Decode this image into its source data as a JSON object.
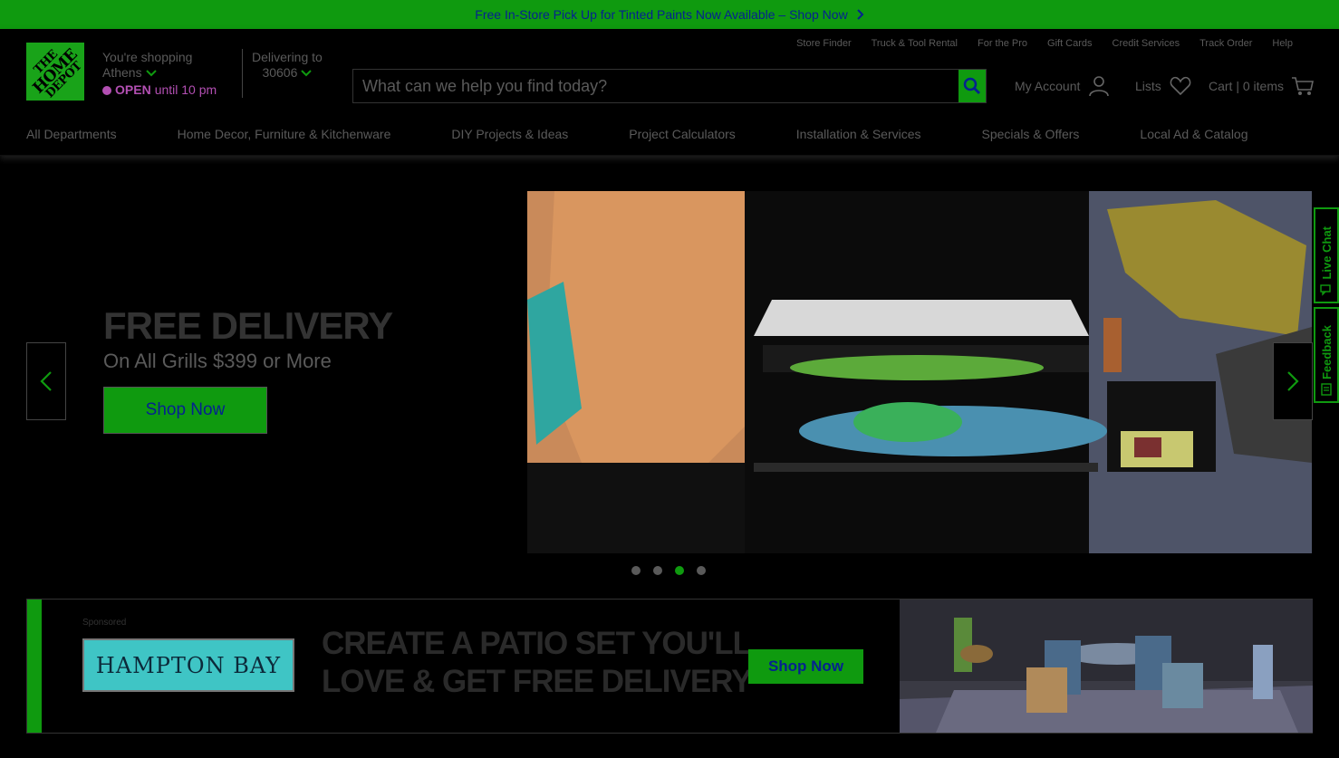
{
  "promo": {
    "text": "Free In-Store Pick Up for Tinted Paints Now Available – Shop Now"
  },
  "logo": {
    "line1": "THE",
    "line2": "HOME",
    "line3": "DEPOT"
  },
  "store": {
    "label": "You're shopping",
    "city": "Athens",
    "status": "OPEN",
    "hours": "until 10 pm"
  },
  "delivery": {
    "label": "Delivering to",
    "zip": "30606"
  },
  "util_links": [
    "Store Finder",
    "Truck & Tool Rental",
    "For the Pro",
    "Gift Cards",
    "Credit Services",
    "Track Order",
    "Help"
  ],
  "search": {
    "placeholder": "What can we help you find today?"
  },
  "account": {
    "my_account": "My Account",
    "lists": "Lists",
    "cart": "Cart | 0 items"
  },
  "nav": [
    "All Departments",
    "Home Decor, Furniture & Kitchenware",
    "DIY Projects & Ideas",
    "Project Calculators",
    "Installation & Services",
    "Specials & Offers",
    "Local Ad & Catalog"
  ],
  "hero": {
    "title": "FREE DELIVERY",
    "subtitle": "On All Grills $399 or More",
    "cta": "Shop Now",
    "active_slide": 3,
    "slide_count": 4
  },
  "side_tabs": {
    "live_chat": "Live Chat",
    "feedback": "Feedback"
  },
  "banner": {
    "sponsored": "Sponsored",
    "brand": "HAMPTON BAY",
    "headline_line1": "CREATE A PATIO SET YOU'LL",
    "headline_line2": "LOVE & GET FREE DELIVERY",
    "cta": "Shop Now"
  },
  "colors": {
    "brand_green": "#0f9a0f",
    "text_blue": "#05228f",
    "open_purple": "#b24fb2"
  }
}
